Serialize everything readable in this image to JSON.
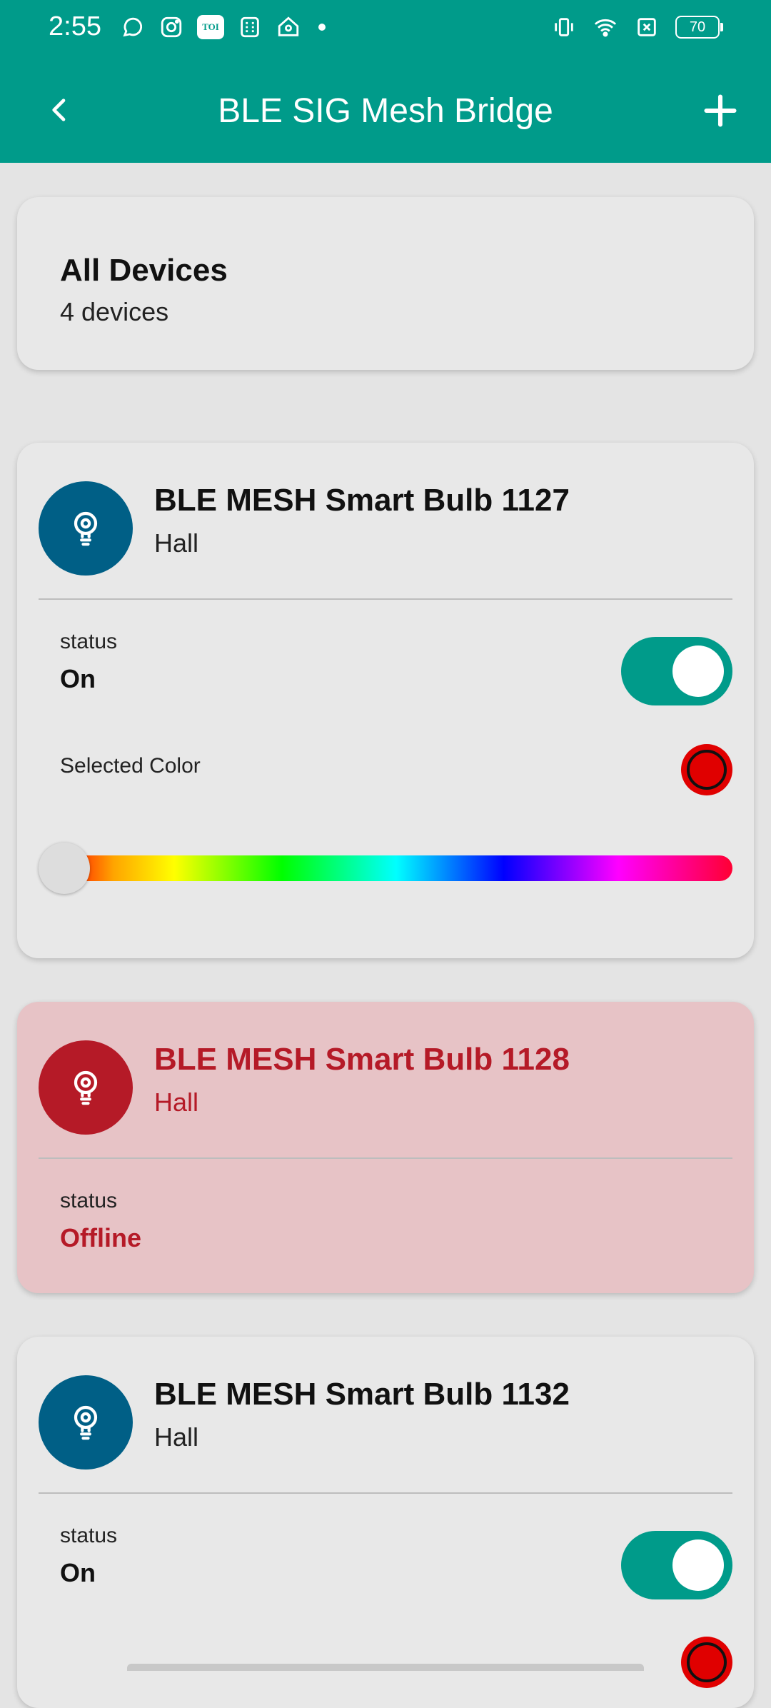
{
  "status_bar": {
    "time": "2:55",
    "battery": "70",
    "icons_left": [
      "whatsapp-icon",
      "instagram-icon",
      "toi-icon",
      "calculator-icon",
      "home-icon",
      "dot-icon"
    ],
    "icons_right": [
      "vibrate-icon",
      "wifi-icon",
      "sim-blocked-icon",
      "battery-icon"
    ],
    "toi_label": "TOI"
  },
  "app_bar": {
    "title": "BLE SIG Mesh Bridge",
    "back_icon": "back-arrow-icon",
    "add_icon": "plus-icon"
  },
  "summary": {
    "title": "All Devices",
    "count": "4 devices"
  },
  "devices": [
    {
      "name": "BLE MESH Smart Bulb 1127",
      "room": "Hall",
      "status_label": "status",
      "status_value": "On",
      "online": true,
      "toggle_on": true,
      "color_label": "Selected Color",
      "selected_color": "#e00000",
      "hue_position": 0.0
    },
    {
      "name": "BLE MESH Smart Bulb 1128",
      "room": "Hall",
      "status_label": "status",
      "status_value": "Offline",
      "online": false
    },
    {
      "name": "BLE MESH Smart Bulb 1132",
      "room": "Hall",
      "status_label": "status",
      "status_value": "On",
      "online": true,
      "toggle_on": true
    }
  ],
  "colors": {
    "primary": "#009b8a",
    "bulb_online": "#005f86",
    "bulb_offline": "#b51a27",
    "offline_card_bg": "#e7c3c6"
  }
}
